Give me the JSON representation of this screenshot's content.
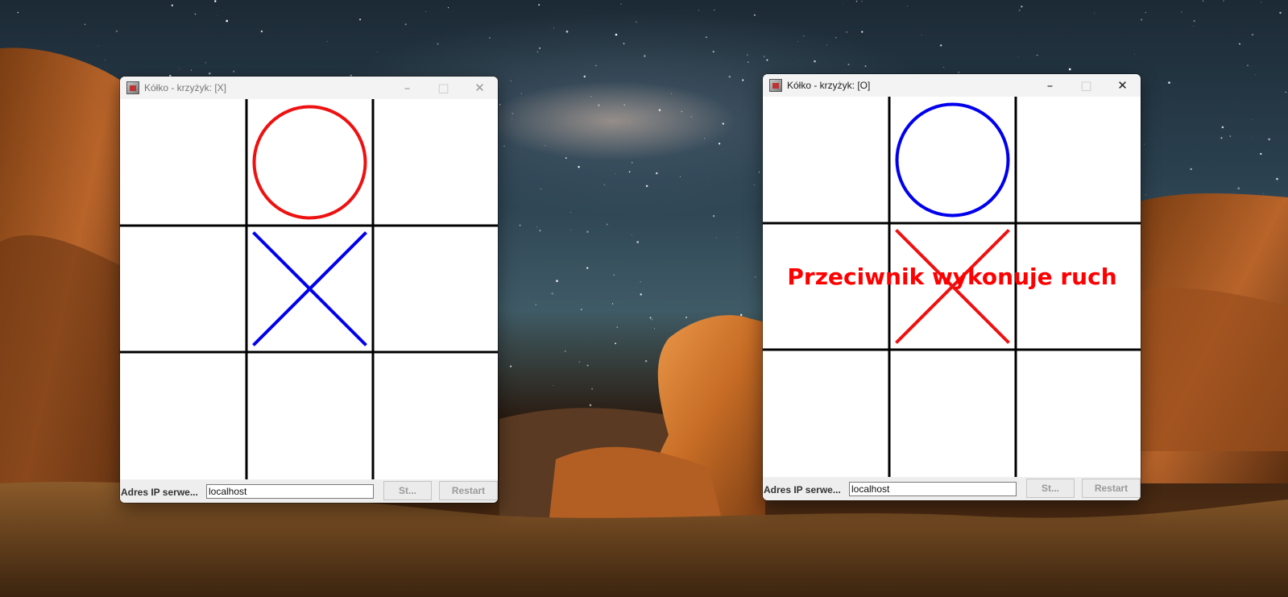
{
  "windows": [
    {
      "title": "Kółko - krzyżyk: [X]",
      "active": false,
      "board": [
        "",
        "O",
        "",
        "",
        "X",
        "",
        "",
        "",
        ""
      ],
      "o_color": "#ee1111",
      "x_color": "#0000ee",
      "message": "",
      "ip_label": "Adres IP serwe...",
      "ip_value": "localhost",
      "start_label": "St...",
      "restart_label": "Restart"
    },
    {
      "title": "Kółko - krzyżyk: [O]",
      "active": true,
      "board": [
        "",
        "O",
        "",
        "",
        "X",
        "",
        "",
        "",
        ""
      ],
      "o_color": "#0000ee",
      "x_color": "#ee1111",
      "message": "Przeciwnik wykonuje ruch",
      "ip_label": "Adres IP serwe...",
      "ip_value": "localhost",
      "start_label": "St...",
      "restart_label": "Restart"
    }
  ]
}
